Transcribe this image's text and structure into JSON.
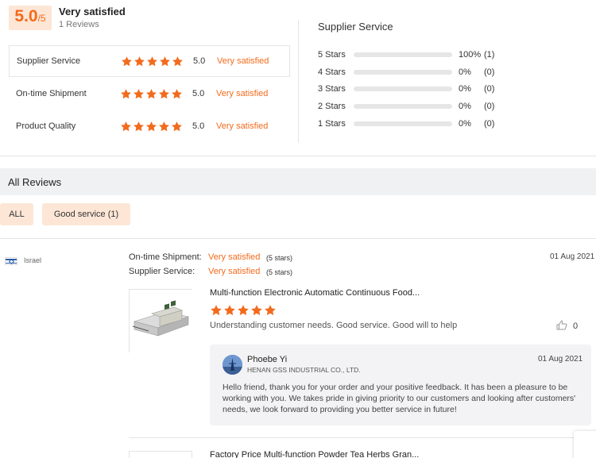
{
  "summary": {
    "score": "5.0",
    "score_max": "/5",
    "rating_text": "Very satisfied",
    "reviews_count": "1 Reviews",
    "metrics": [
      {
        "label": "Supplier Service",
        "stars": 5,
        "score": "5.0",
        "text": "Very satisfied"
      },
      {
        "label": "On-time Shipment",
        "stars": 5,
        "score": "5.0",
        "text": "Very satisfied"
      },
      {
        "label": "Product Quality",
        "stars": 5,
        "score": "5.0",
        "text": "Very satisfied"
      }
    ]
  },
  "breakdown": {
    "title": "Supplier Service",
    "rows": [
      {
        "label": "5  Stars",
        "fraction": 1.0,
        "percent": "100%",
        "count": "(1)"
      },
      {
        "label": "4  Stars",
        "fraction": 0,
        "percent": "0%",
        "count": "(0)"
      },
      {
        "label": "3  Stars",
        "fraction": 0,
        "percent": "0%",
        "count": "(0)"
      },
      {
        "label": "2  Stars",
        "fraction": 0,
        "percent": "0%",
        "count": "(0)"
      },
      {
        "label": "1  Stars",
        "fraction": 0,
        "percent": "0%",
        "count": "(0)"
      }
    ]
  },
  "all_reviews": {
    "title": "All Reviews",
    "filters": [
      "ALL",
      "Good service (1)"
    ]
  },
  "review": {
    "country": "Israel",
    "date": "01 Aug 2021",
    "shipment_label": "On-time Shipment:",
    "shipment_value": "Very satisfied",
    "shipment_stars": "(5 stars)",
    "service_label": "Supplier Service:",
    "service_value": "Very satisfied",
    "service_stars": "(5 stars)",
    "product_title": "Multi-function Electronic Automatic Continuous Food...",
    "product_stars": 5,
    "comment": "Understanding customer needs. Good service. Good will to help",
    "likes": "0",
    "reply": {
      "name": "Phoebe Yi",
      "company": "HENAN GSS INDUSTRIAL CO., LTD.",
      "date": "01 Aug 2021",
      "text": "Hello friend, thank you for your order and your positive feedback. It has been a pleasure to be working with you. We takes pride in giving priority to our customers and looking after customers' needs, we look forward to providing you better service in future!"
    }
  },
  "next_review": {
    "product_title": "Factory Price Multi-function Powder Tea Herbs Gran..."
  },
  "colors": {
    "accent": "#f26b1d",
    "accent_bg": "#fde6d6",
    "header_bg": "#f0f1f3"
  },
  "icons": {
    "star": "star-icon",
    "like": "thumbs-up-icon",
    "flag": "israel-flag-icon"
  }
}
